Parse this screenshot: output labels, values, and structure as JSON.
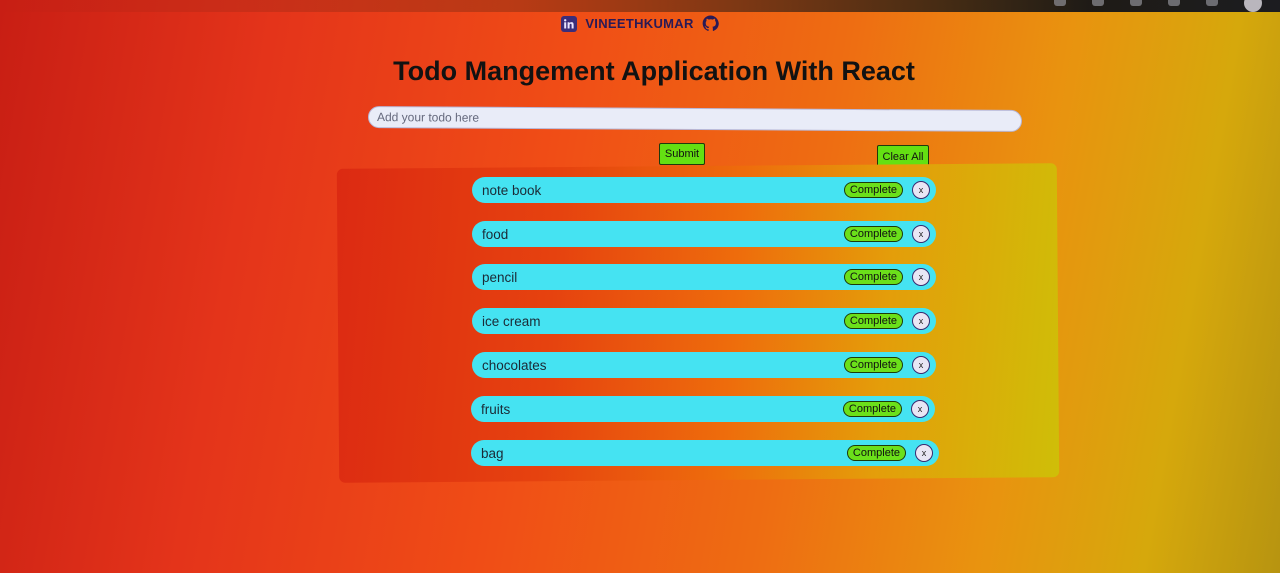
{
  "header": {
    "author": "VINEETHKUMAR"
  },
  "page_title": "Todo Mangement Application With React",
  "input": {
    "value": "",
    "placeholder": "Add your todo here"
  },
  "buttons": {
    "submit": "Submit",
    "clear_all": "Clear All"
  },
  "todos": [
    {
      "text": "note book",
      "complete_label": "Complete",
      "delete_label": "x"
    },
    {
      "text": "food",
      "complete_label": "Complete",
      "delete_label": "x"
    },
    {
      "text": "pencil",
      "complete_label": "Complete",
      "delete_label": "x"
    },
    {
      "text": "ice cream",
      "complete_label": "Complete",
      "delete_label": "x"
    },
    {
      "text": "chocolates",
      "complete_label": "Complete",
      "delete_label": "x"
    },
    {
      "text": "fruits",
      "complete_label": "Complete",
      "delete_label": "x"
    },
    {
      "text": "bag",
      "complete_label": "Complete",
      "delete_label": "x"
    }
  ],
  "icons": {
    "linkedin": "linkedin-icon",
    "github": "github-icon"
  },
  "colors": {
    "accent_green": "#64e012",
    "item_cyan": "#45e3f2",
    "title_text": "#121212"
  }
}
